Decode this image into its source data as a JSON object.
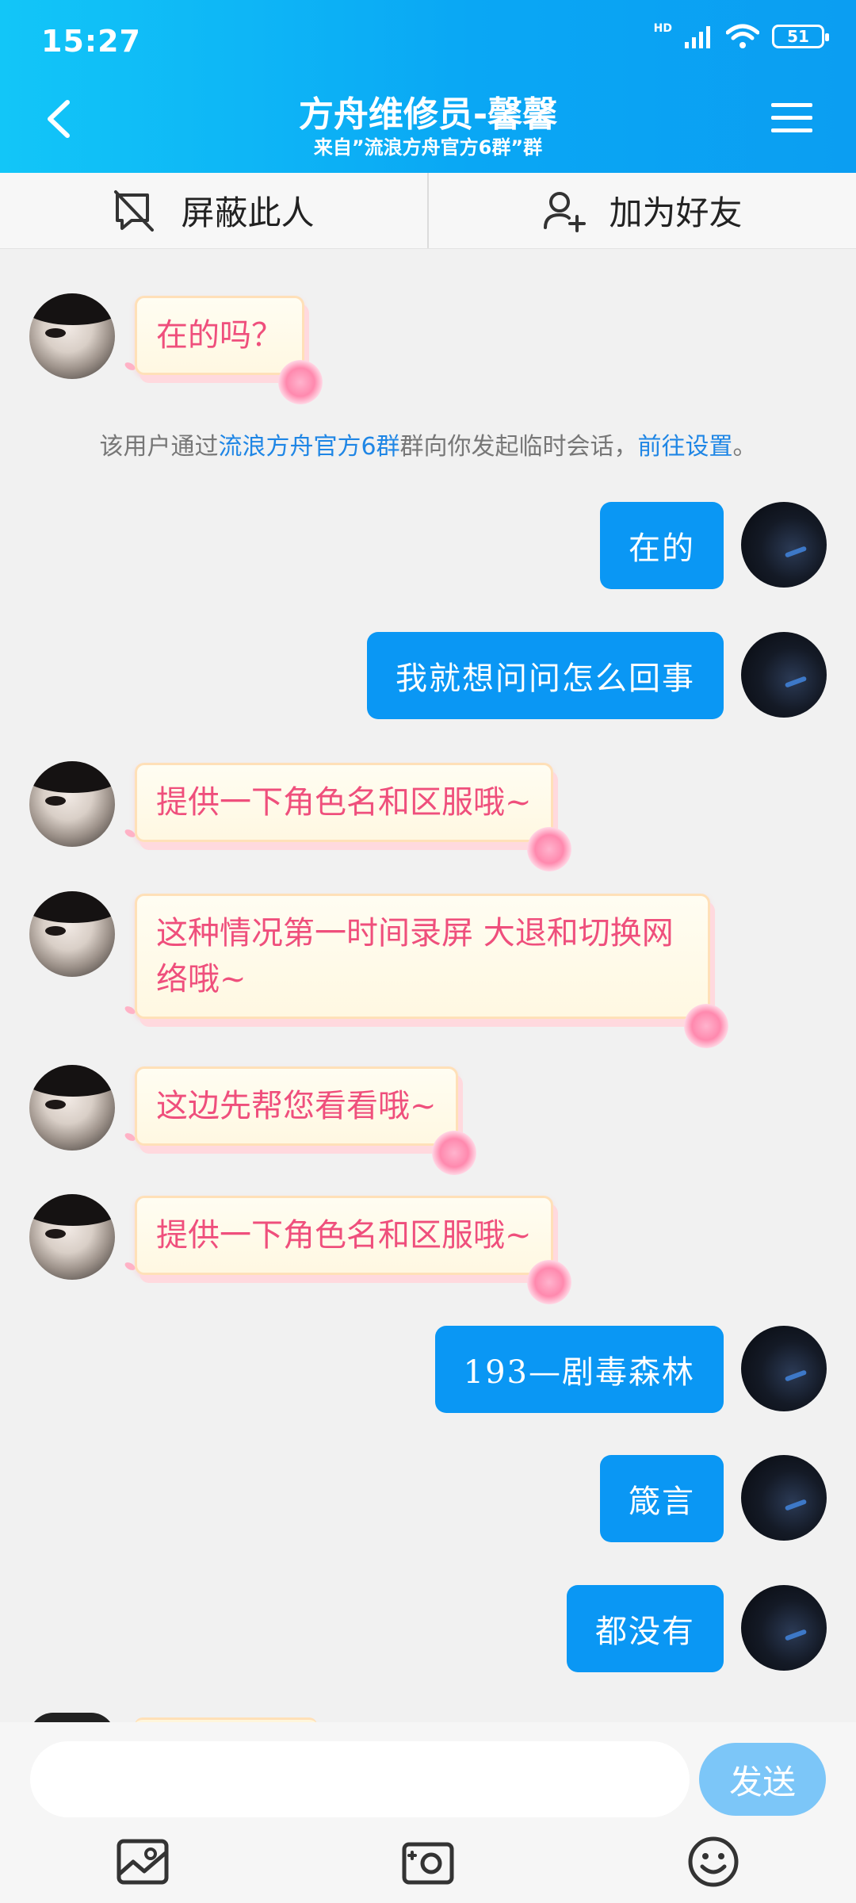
{
  "status_bar": {
    "time": "15:27",
    "network_label": "HD",
    "battery": "51"
  },
  "header": {
    "title": "方舟维修员-馨馨",
    "subtitle": "来自”流浪方舟官方6群”群"
  },
  "actions": {
    "block_label": "屏蔽此人",
    "add_friend_label": "加为好友"
  },
  "messages": [
    {
      "side": "left",
      "text": "在的吗？"
    },
    {
      "side": "right",
      "text": "在的"
    },
    {
      "side": "right",
      "text": "我就想问问怎么回事"
    },
    {
      "side": "left",
      "text": "提供一下角色名和区服哦~"
    },
    {
      "side": "left",
      "text": "这种情况第一时间录屏 大退和切换网络哦~"
    },
    {
      "side": "left",
      "text": "这边先帮您看看哦~"
    },
    {
      "side": "left",
      "text": "提供一下角色名和区服哦~"
    },
    {
      "side": "right",
      "text": "193—剧毒森林"
    },
    {
      "side": "right",
      "text": "箴言"
    },
    {
      "side": "right",
      "text": "都没有"
    }
  ],
  "system_notice": {
    "prefix": "该用户通过",
    "group_link": "流浪方舟官方6群",
    "middle": "群向你发起临时会话，",
    "settings_link": "前往设置",
    "suffix": "。"
  },
  "input": {
    "placeholder": "",
    "send_label": "发送"
  },
  "icons": [
    "back-icon",
    "menu-icon",
    "block-icon",
    "add-friend-icon",
    "image-icon",
    "camera-icon",
    "emoji-icon"
  ],
  "colors": {
    "header": "#0aa7f4",
    "bubble_right": "#0a97f4",
    "bubble_left_text": "#ef4f7c",
    "link": "#1f86e5",
    "send_button": "#7cc6f8"
  }
}
